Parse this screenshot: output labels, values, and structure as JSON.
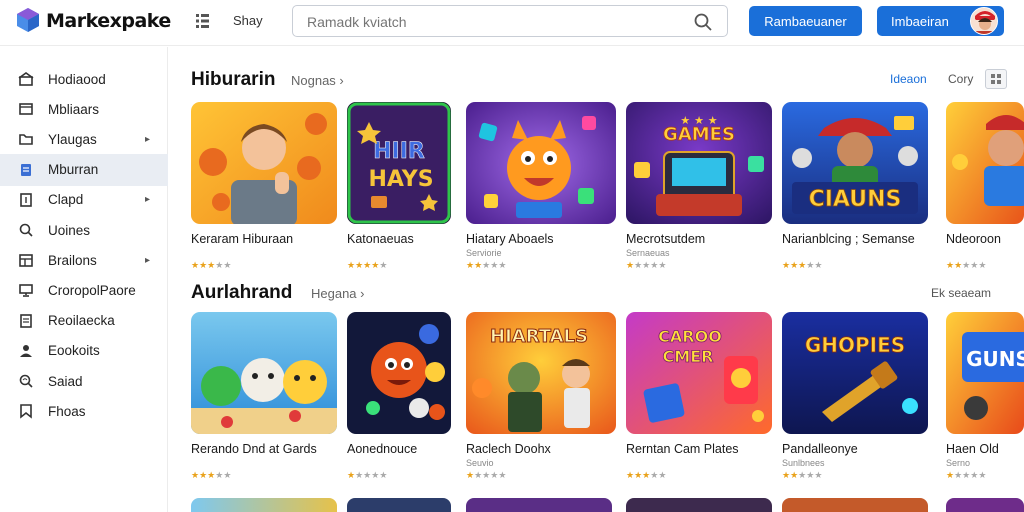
{
  "header": {
    "brand": "Markexpake",
    "shop_label": "Shay",
    "search_placeholder": "Ramadk kviatch",
    "button_primary": "Rambaeuaner",
    "button_account": "Imbaeiran"
  },
  "sidebar": {
    "items": [
      {
        "label": "Hodiaood",
        "icon": "home-icon",
        "chevron": false,
        "active": false
      },
      {
        "label": "Mbliaars",
        "icon": "box-icon",
        "chevron": false,
        "active": false
      },
      {
        "label": "Ylaugas",
        "icon": "folder-icon",
        "chevron": true,
        "active": false
      },
      {
        "label": "Mburran",
        "icon": "doc-icon",
        "chevron": false,
        "active": true
      },
      {
        "label": "Clapd",
        "icon": "tag-icon",
        "chevron": true,
        "active": false
      },
      {
        "label": "Uoines",
        "icon": "search-icon",
        "chevron": false,
        "active": false
      },
      {
        "label": "Brailons",
        "icon": "layers-icon",
        "chevron": true,
        "active": false
      },
      {
        "label": "CroropolPaore",
        "icon": "monitor-icon",
        "chevron": false,
        "active": false
      },
      {
        "label": "Reoilaecka",
        "icon": "list-icon",
        "chevron": false,
        "active": false
      },
      {
        "label": "Eookoits",
        "icon": "person-icon",
        "chevron": false,
        "active": false
      },
      {
        "label": "Saiad",
        "icon": "magnifier-icon",
        "chevron": false,
        "active": false
      },
      {
        "label": "Fhoas",
        "icon": "bookmark-icon",
        "chevron": false,
        "active": false
      }
    ],
    "chevron_glyph": "▸"
  },
  "section1": {
    "title": "Hiburarin",
    "subtitle": "Nognas ›",
    "right_label_1": "Ideaon",
    "right_label_2": "Cory",
    "cards": [
      {
        "title": "Keraram Hiburaan",
        "meta": "",
        "stars": 3
      },
      {
        "title": "Katonaeuas",
        "meta": "",
        "stars": 4
      },
      {
        "title": "Hiatary Aboaels",
        "meta": "Serviorie",
        "stars": 2
      },
      {
        "title": "Mecrotsutdem",
        "meta": "Sernaeuas",
        "stars": 1
      },
      {
        "title": "Narianblcing ; Semanse",
        "meta": "",
        "stars": 3
      },
      {
        "title": "Ndeoroon",
        "meta": "",
        "stars": 2
      }
    ]
  },
  "section2": {
    "title": "Aurlahrand",
    "subtitle": "Hegana ›",
    "right_label": "Ek seaeam",
    "cards": [
      {
        "title": "Rerando Dnd at Gards",
        "meta": "",
        "stars": 3
      },
      {
        "title": "Aonednouce",
        "meta": "",
        "stars": 1
      },
      {
        "title": "Raclech Doohx",
        "meta": "Seuvio",
        "stars": 1
      },
      {
        "title": "Rerntan Cam Plates",
        "meta": "",
        "stars": 3
      },
      {
        "title": "Pandalleonye",
        "meta": "Sunlbnees",
        "stars": 2
      },
      {
        "title": "Haen Old",
        "meta": "Serno",
        "stars": 1
      }
    ]
  },
  "thumb_texts": {
    "s1c2": [
      "HIIR",
      "HAYS"
    ],
    "s1c3": [
      "GAMES"
    ],
    "s1c5": [
      "CIAUNS"
    ],
    "s2c3": [
      "HIARTALS"
    ],
    "s2c4": [
      "CAROO",
      "CMER"
    ],
    "s2c5": [
      "GHOPIES"
    ],
    "s2c6": [
      "GUNS"
    ]
  },
  "colors": {
    "accent": "#1a6fd9",
    "star": "#e9a21b",
    "active_bg": "#e9edf3"
  }
}
